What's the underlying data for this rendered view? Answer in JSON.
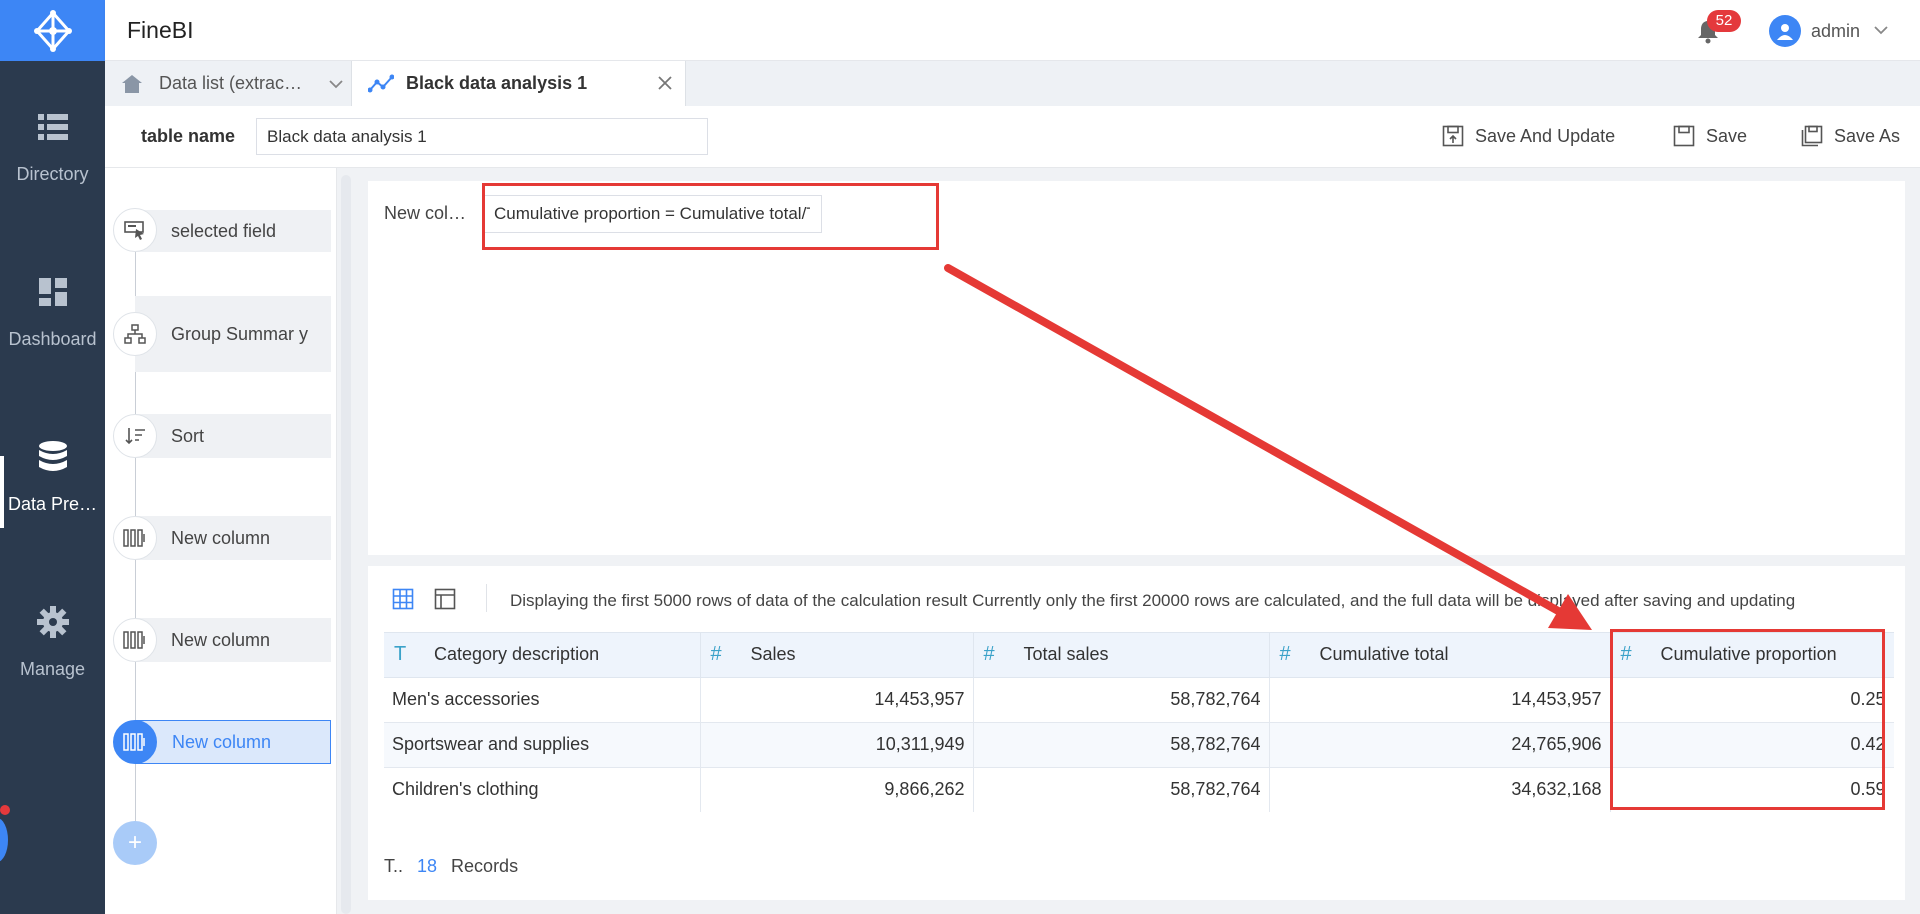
{
  "app": {
    "title": "FineBI",
    "notification_count": "52",
    "username": "admin"
  },
  "nav": [
    {
      "label": "Directory",
      "icon": "list-icon"
    },
    {
      "label": "Dashboard",
      "icon": "dashboard-icon"
    },
    {
      "label": "Data Pre…",
      "icon": "database-icon",
      "active": true
    },
    {
      "label": "Manage",
      "icon": "gear-icon"
    }
  ],
  "tabs": [
    {
      "label": "Data list (extrac…",
      "icon": "home-icon"
    },
    {
      "label": "Black data analysis 1",
      "icon": "line-chart-icon"
    }
  ],
  "toolbar": {
    "table_name_label": "table name",
    "table_name_value": "Black data analysis 1",
    "save_update": "Save And Update",
    "save": "Save",
    "save_as": "Save As"
  },
  "steps": [
    {
      "label": "selected field",
      "icon": "select-field-icon"
    },
    {
      "label": "Group Summar y",
      "icon": "hierarchy-icon"
    },
    {
      "label": "Sort",
      "icon": "sort-icon"
    },
    {
      "label": "New column",
      "icon": "columns-icon"
    },
    {
      "label": "New column",
      "icon": "columns-icon"
    },
    {
      "label": "New column",
      "icon": "columns-icon",
      "active": true
    }
  ],
  "add_step": "+",
  "formula": {
    "label": "New col…",
    "value": "Cumulative proportion = Cumulative total/Total sales"
  },
  "preview": {
    "message": "Displaying the first 5000 rows of data of the calculation result  Currently only the first 20000 rows are calculated, and the full data will be displayed after saving and updating",
    "columns": [
      {
        "type": "T",
        "name": "Category description"
      },
      {
        "type": "#",
        "name": "Sales"
      },
      {
        "type": "#",
        "name": "Total sales"
      },
      {
        "type": "#",
        "name": "Cumulative total"
      },
      {
        "type": "#",
        "name": "Cumulative proportion"
      }
    ],
    "rows": [
      [
        "Men's accessories",
        "14,453,957",
        "58,782,764",
        "14,453,957",
        "0.25"
      ],
      [
        "Sportswear and supplies",
        "10,311,949",
        "58,782,764",
        "24,765,906",
        "0.42"
      ],
      [
        "Children's clothing",
        "9,866,262",
        "58,782,764",
        "34,632,168",
        "0.59"
      ]
    ],
    "footer_prefix": "T..",
    "record_count": "18",
    "footer_suffix": "Records"
  },
  "colors": {
    "accent": "#3d86f5",
    "nav_bg": "#2b3a4e",
    "highlight": "#e53935"
  }
}
